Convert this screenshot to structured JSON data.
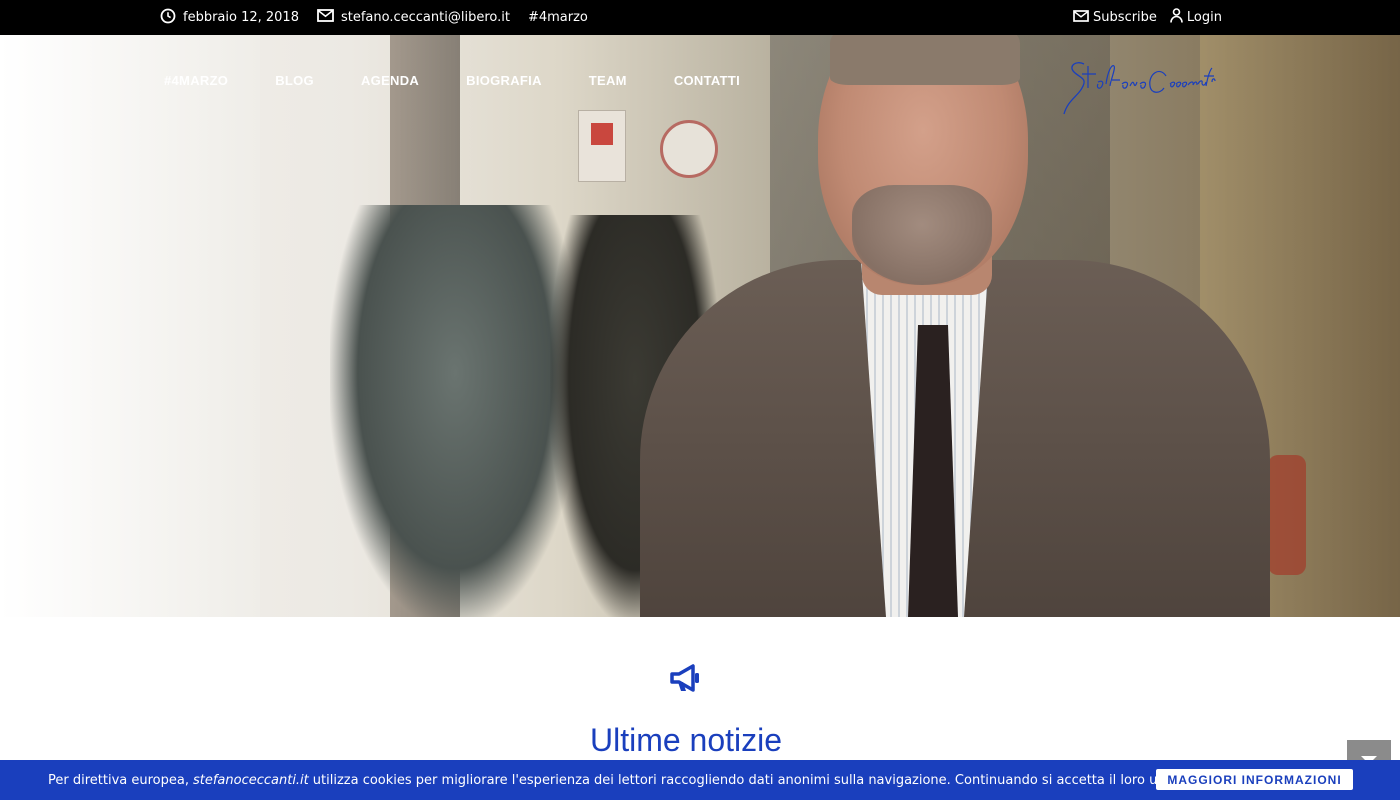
{
  "topbar": {
    "date": "febbraio 12, 2018",
    "email": "stefano.ceccanti@libero.it",
    "hashtag": "#4marzo",
    "subscribe": "Subscribe",
    "login": "Login"
  },
  "nav": {
    "items": [
      {
        "label": "#4MARZO"
      },
      {
        "label": "BLOG"
      },
      {
        "label": "AGENDA"
      },
      {
        "label": "BIOGRAFIA"
      },
      {
        "label": "TEAM"
      },
      {
        "label": "CONTATTI"
      }
    ]
  },
  "logo": {
    "text": "Stefano Ceccanti",
    "color": "#1a3fbd"
  },
  "section": {
    "title": "Ultime notizie",
    "icon": "megaphone-icon"
  },
  "cookie": {
    "text_before": "Per direttiva europea,",
    "site": "stefanoceccanti.it",
    "text_after": "utilizza cookies per migliorare l'esperienza dei lettori raccogliendo dati anonimi sulla navigazione. Continuando si accetta il loro uso.",
    "button": "MAGGIORI INFORMAZIONI"
  },
  "colors": {
    "accent": "#1a3fbd",
    "topbar": "#000000"
  }
}
